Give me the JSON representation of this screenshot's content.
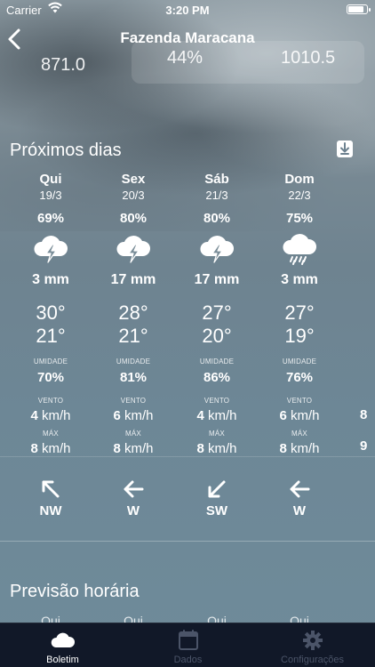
{
  "status_bar": {
    "carrier": "Carrier",
    "time": "3:20 PM"
  },
  "nav": {
    "title": "Fazenda Maracana"
  },
  "top_values": {
    "left": "871.0",
    "middle": "44%",
    "right": "1010.5"
  },
  "forecast": {
    "title": "Próximos dias",
    "humidity_label": "UMIDADE",
    "wind_label": "VENTO",
    "max_label": "MÁX",
    "days": [
      {
        "name": "Qui",
        "date": "19/3",
        "prob": "69%",
        "icon": "thunderstorm-icon",
        "rain": "3 mm",
        "tmax": "30°",
        "tmin": "21°",
        "humidity": "70%",
        "wind_value": "4",
        "wind_unit": "km/h",
        "gust_value": "8",
        "gust_unit": "km/h",
        "dir": "NW"
      },
      {
        "name": "Sex",
        "date": "20/3",
        "prob": "80%",
        "icon": "thunderstorm-icon",
        "rain": "17 mm",
        "tmax": "28°",
        "tmin": "21°",
        "humidity": "81%",
        "wind_value": "6",
        "wind_unit": "km/h",
        "gust_value": "8",
        "gust_unit": "km/h",
        "dir": "W"
      },
      {
        "name": "Sáb",
        "date": "21/3",
        "prob": "80%",
        "icon": "thunderstorm-icon",
        "rain": "17 mm",
        "tmax": "27°",
        "tmin": "20°",
        "humidity": "86%",
        "wind_value": "4",
        "wind_unit": "km/h",
        "gust_value": "8",
        "gust_unit": "km/h",
        "dir": "SW"
      },
      {
        "name": "Dom",
        "date": "22/3",
        "prob": "75%",
        "icon": "rain-icon",
        "rain": "3 mm",
        "tmax": "27°",
        "tmin": "19°",
        "humidity": "76%",
        "wind_value": "6",
        "wind_unit": "km/h",
        "gust_value": "8",
        "gust_unit": "km/h",
        "dir": "W"
      }
    ],
    "partial_next": {
      "wind": "8",
      "gust": "9"
    }
  },
  "hourly": {
    "title": "Previsão horária",
    "days": [
      "Qui",
      "Qui",
      "Qui",
      "Qui"
    ]
  },
  "tabbar": {
    "items": [
      {
        "label": "Boletim"
      },
      {
        "label": "Dados"
      },
      {
        "label": "Configurações"
      }
    ]
  },
  "colors": {
    "tab_bg": "#111828",
    "tab_active": "#ffffff",
    "tab_inactive": "#4b5468"
  }
}
